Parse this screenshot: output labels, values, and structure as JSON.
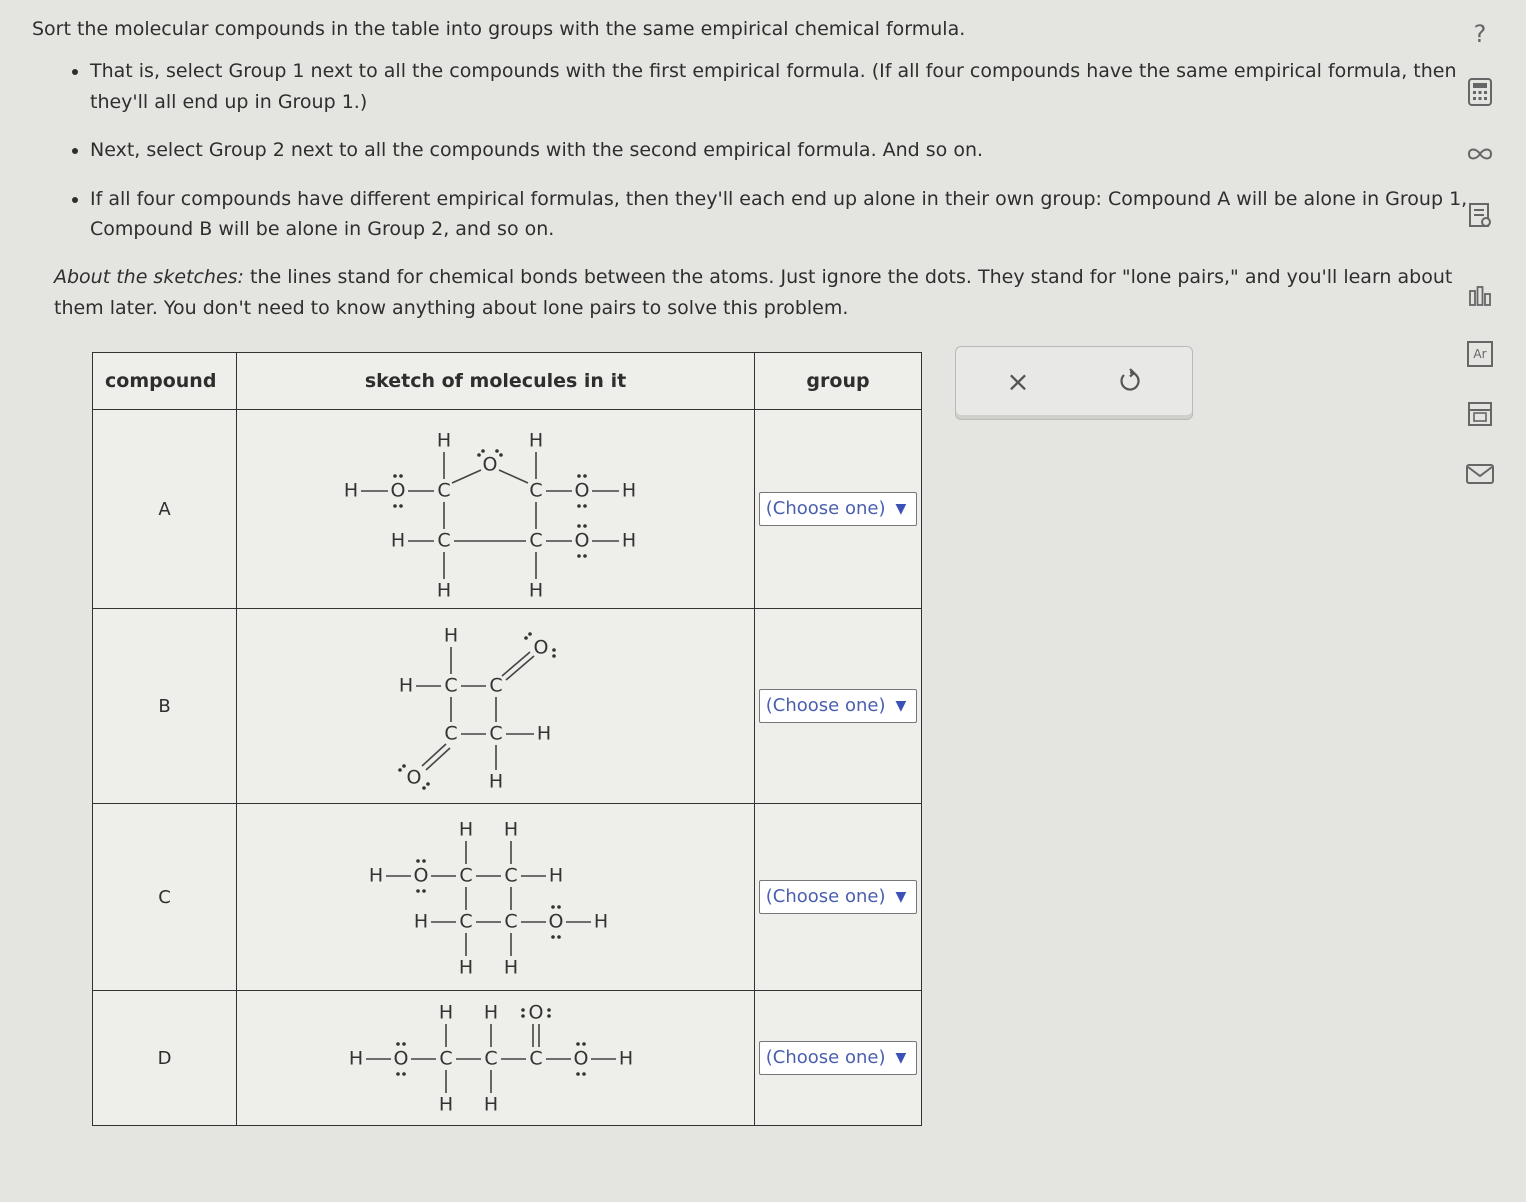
{
  "instructions": {
    "heading": "Sort the molecular compounds in the table into groups with the same empirical chemical formula.",
    "bullet1": "That is, select Group 1 next to all the compounds with the first empirical formula. (If all four compounds have the same empirical formula, then they'll all end up in Group 1.)",
    "bullet2": "Next, select Group 2 next to all the compounds with the second empirical formula. And so on.",
    "bullet3": "If all four compounds have different empirical formulas, then they'll each end up alone in their own group: Compound A will be alone in Group 1, Compound B will be alone in Group 2, and so on.",
    "about_label": "About the sketches:",
    "about_text": "the lines stand for chemical bonds between the atoms. Just ignore the dots. They stand for \"lone pairs,\" and you'll learn about them later. You don't need to know anything about lone pairs to solve this problem."
  },
  "table": {
    "headers": {
      "compound": "compound",
      "sketch": "sketch of molecules in it",
      "group": "group"
    },
    "rows": [
      {
        "compound": "A",
        "group_value": "(Choose one)"
      },
      {
        "compound": "B",
        "group_value": "(Choose one)"
      },
      {
        "compound": "C",
        "group_value": "(Choose one)"
      },
      {
        "compound": "D",
        "group_value": "(Choose one)"
      }
    ]
  },
  "atoms": {
    "H": "H",
    "C": "C",
    "O": "O"
  },
  "answer_panel": {
    "clear_symbol": "×"
  },
  "toolbar": {
    "help": "?",
    "tools": [
      "calculator-icon",
      "infinity-icon",
      "data-sheet-icon",
      "bar-chart-icon",
      "periodic-table-icon",
      "calendar-icon",
      "mail-icon"
    ],
    "periodic_label": "Ar"
  },
  "colors": {
    "select_text": "#4a5fae",
    "background": "#e4e5e1"
  }
}
